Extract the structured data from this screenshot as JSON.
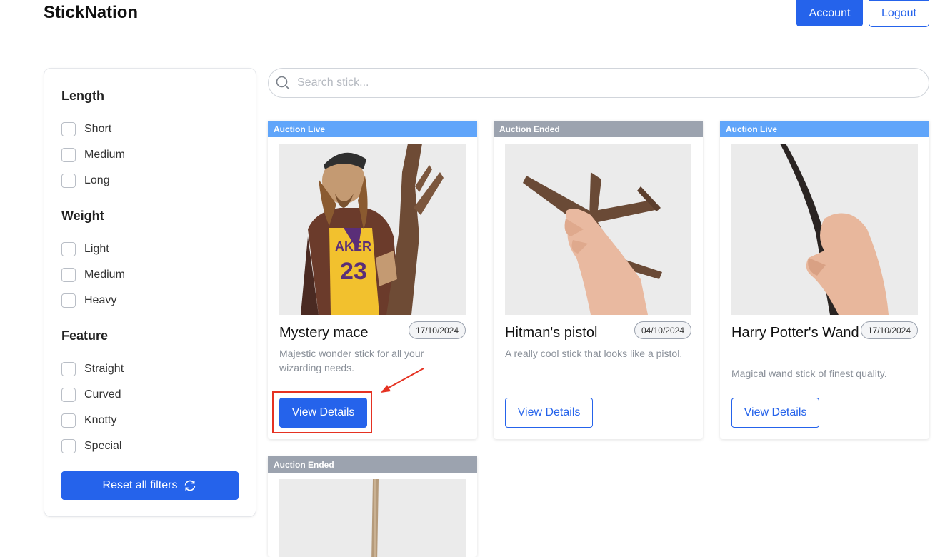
{
  "header": {
    "brand": "StickNation",
    "account_label": "Account",
    "logout_label": "Logout"
  },
  "filters": {
    "length": {
      "title": "Length",
      "options": [
        "Short",
        "Medium",
        "Long"
      ]
    },
    "weight": {
      "title": "Weight",
      "options": [
        "Light",
        "Medium",
        "Heavy"
      ]
    },
    "feature": {
      "title": "Feature",
      "options": [
        "Straight",
        "Curved",
        "Knotty",
        "Special"
      ]
    },
    "reset_label": "Reset all filters",
    "reset_icon": "refresh-icon"
  },
  "search": {
    "placeholder": "Search stick...",
    "value": ""
  },
  "cards": [
    {
      "status": "Auction Live",
      "title": "Mystery mace",
      "date": "17/10/2024",
      "description": "Majestic wonder stick for all your wizarding needs.",
      "button": "View Details"
    },
    {
      "status": "Auction Ended",
      "title": "Hitman's pistol",
      "date": "04/10/2024",
      "description": "A really cool stick that looks like a pistol.",
      "button": "View Details"
    },
    {
      "status": "Auction Live",
      "title": "Harry Potter's Wand",
      "date": "17/10/2024",
      "description": "Magical wand stick of finest quality.",
      "button": "View Details"
    },
    {
      "status": "Auction Ended"
    }
  ],
  "colors": {
    "primary": "#2563eb",
    "live": "#60a5fa",
    "ended": "#9ca3af",
    "annotation": "#e53222"
  }
}
